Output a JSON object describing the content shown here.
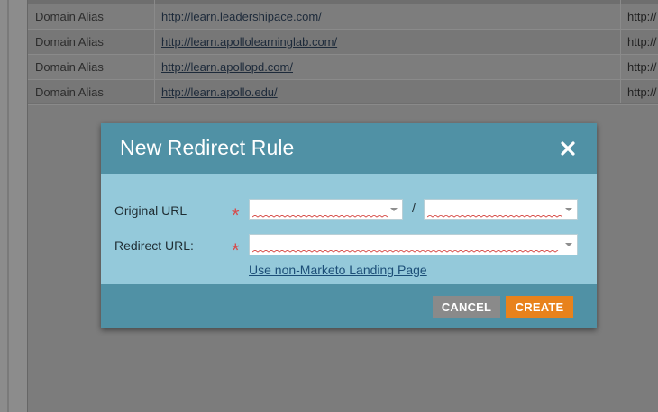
{
  "background_table": {
    "rows": [
      {
        "type": "Domain Alias",
        "source": "http://learn.leadershipace.com/",
        "dest": "http://"
      },
      {
        "type": "Domain Alias",
        "source": "http://learn.apollolearninglab.com/",
        "dest": "http://"
      },
      {
        "type": "Domain Alias",
        "source": "http://learn.apollopd.com/",
        "dest": "http://"
      },
      {
        "type": "Domain Alias",
        "source": "http://learn.apollo.edu/",
        "dest": "http://"
      }
    ]
  },
  "modal": {
    "title": "New Redirect Rule",
    "close_icon": "close-icon",
    "fields": {
      "original_url": {
        "label": "Original URL",
        "required_mark": "*",
        "domain_value": "",
        "path_value": "",
        "separator": "/"
      },
      "redirect_url": {
        "label": "Redirect URL:",
        "required_mark": "*",
        "value": ""
      }
    },
    "link_text": "Use non-Marketo Landing Page",
    "buttons": {
      "cancel": "CANCEL",
      "create": "CREATE"
    }
  },
  "colors": {
    "modal_header": "#5091a5",
    "modal_body": "#94c9da",
    "required": "#d64c4c",
    "create_button": "#e8821c",
    "cancel_button": "#8a8a8a"
  }
}
